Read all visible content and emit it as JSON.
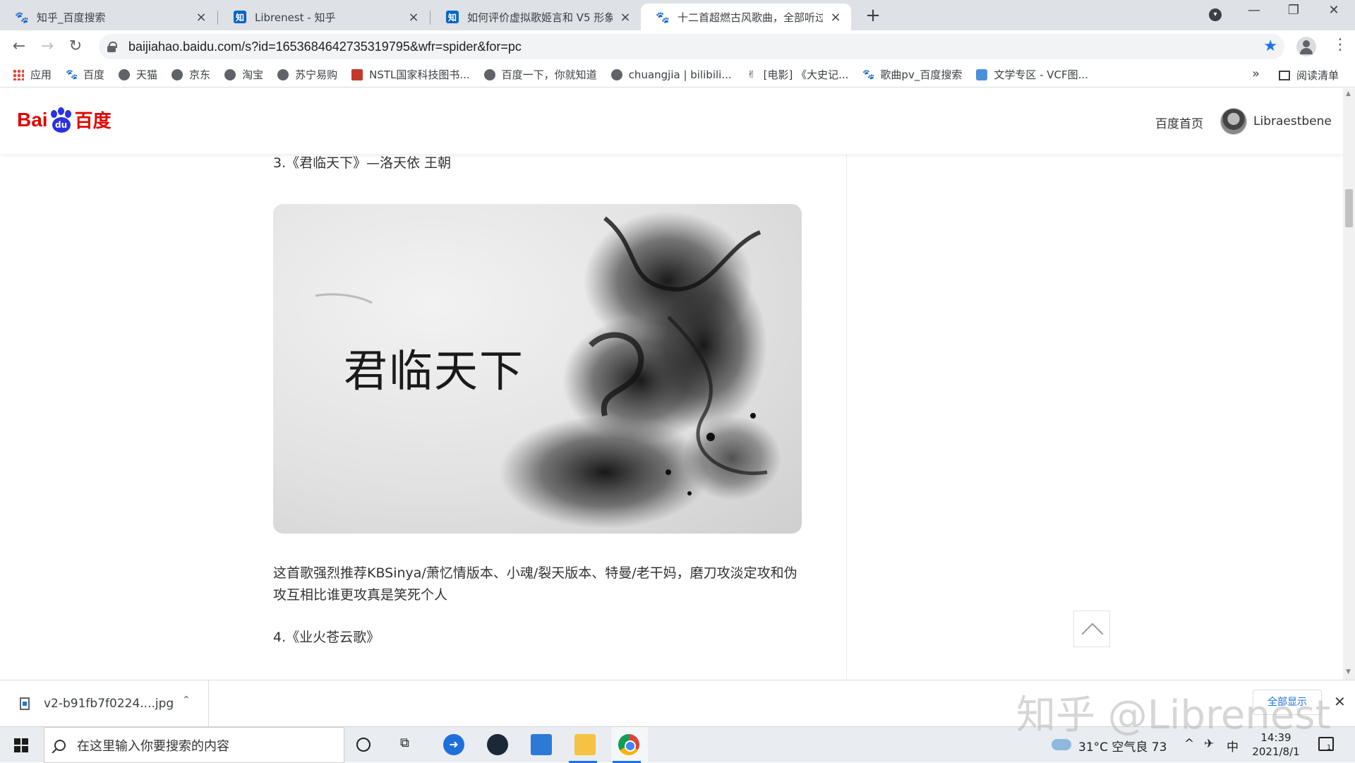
{
  "browser": {
    "tabs": [
      {
        "title": "知乎_百度搜索",
        "favicon": "baidu-paw"
      },
      {
        "title": "Librenest - 知乎",
        "favicon": "zhihu"
      },
      {
        "title": "如何评价虚拟歌姬言和 V5 形象设",
        "favicon": "zhihu"
      },
      {
        "title": "十二首超燃古风歌曲，全部听过？",
        "favicon": "baidu-paw",
        "active": true
      }
    ],
    "new_tab_label": "+",
    "url": "baijiahao.baidu.com/s?id=1653684642735319795&wfr=spider&for=pc",
    "bookmarks": [
      {
        "label": "应用",
        "icon": "apps-grid"
      },
      {
        "label": "百度",
        "icon": "baidu-paw"
      },
      {
        "label": "天猫",
        "icon": "globe"
      },
      {
        "label": "京东",
        "icon": "globe"
      },
      {
        "label": "淘宝",
        "icon": "globe"
      },
      {
        "label": "苏宁易购",
        "icon": "globe"
      },
      {
        "label": "NSTL国家科技图书...",
        "icon": "nstl"
      },
      {
        "label": "百度一下，你就知道",
        "icon": "globe"
      },
      {
        "label": "chuangjia | bilibili...",
        "icon": "globe"
      },
      {
        "label": "[电影] 《大史记...",
        "icon": "hand"
      },
      {
        "label": "歌曲pv_百度搜索",
        "icon": "baidu-paw"
      },
      {
        "label": "文学专区 - VCF图...",
        "icon": "vcf"
      }
    ],
    "bookmarks_overflow": "»",
    "reading_list": "阅读清单"
  },
  "page": {
    "logo": {
      "bai": "Bai",
      "du_badge": "du",
      "du": "百度"
    },
    "header_link": "百度首页",
    "username": "Libraestbene",
    "item3_heading": "3.《君临天下》—洛天依 王朝",
    "image_title": "君临天下",
    "paragraph": "这首歌强烈推荐KBSinya/萧忆情版本、小魂/裂天版本、特曼/老干妈，磨刀攻淡定攻和伪攻互相比谁更攻真是笑死个人",
    "item4_heading": "4.《业火苍云歌》"
  },
  "downloads": {
    "file_name": "v2-b91fb7f0224....jpg",
    "show_all": "全部显示",
    "watermark": "知乎 @Librenest"
  },
  "taskbar": {
    "search_placeholder": "在这里输入你要搜索的内容",
    "weather": "31°C  空气良 73",
    "ime": "中",
    "time": "14:39",
    "date": "2021/8/1",
    "notification_count": "1"
  }
}
